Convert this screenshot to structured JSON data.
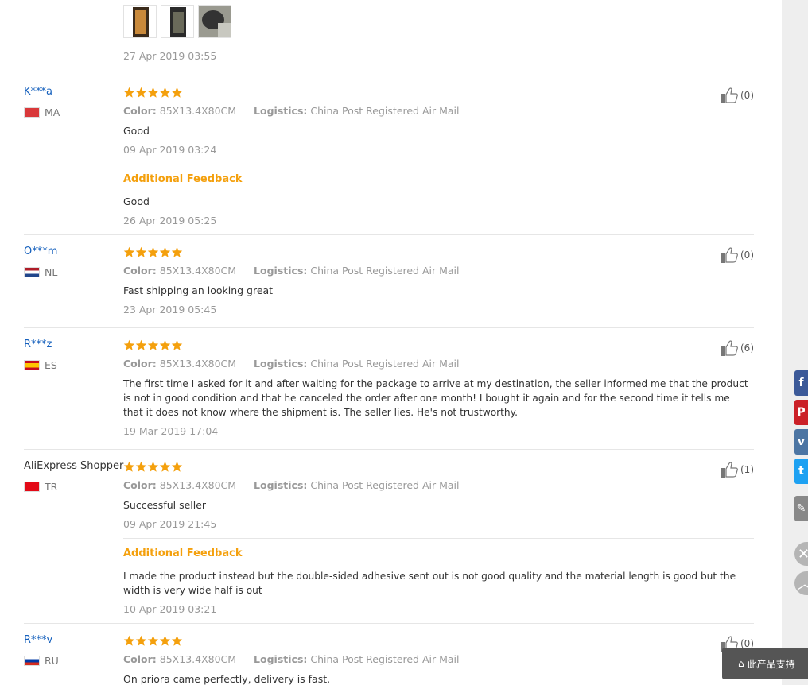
{
  "top_review": {
    "date": "27 Apr 2019 03:55"
  },
  "labels": {
    "color": "Color:",
    "logistics": "Logistics:",
    "additional_feedback": "Additional Feedback"
  },
  "reviews": [
    {
      "user": "K***a",
      "country": "MA",
      "stars": 5,
      "color": "85X13.4X80CM",
      "logistics": "China Post Registered Air Mail",
      "text": "Good",
      "date": "09 Apr 2019 03:24",
      "likes": "(0)",
      "additional_text": "Good",
      "additional_date": "26 Apr 2019 05:25"
    },
    {
      "user": "O***m",
      "country": "NL",
      "stars": 5,
      "color": "85X13.4X80CM",
      "logistics": "China Post Registered Air Mail",
      "text": "Fast shipping an looking great",
      "date": "23 Apr 2019 05:45",
      "likes": "(0)"
    },
    {
      "user": "R***z",
      "country": "ES",
      "stars": 5,
      "color": "85X13.4X80CM",
      "logistics": "China Post Registered Air Mail",
      "text": "The first time I asked for it and after waiting for the package to arrive at my destination, the seller informed me that the product is not in good condition and that he canceled the order after one month! I bought it again and for the second time it tells me that it does not know where the shipment is. The seller lies. He's not trustworthy.",
      "date": "19 Mar 2019 17:04",
      "likes": "(6)"
    },
    {
      "user": "AliExpress Shopper",
      "country": "TR",
      "stars": 5,
      "color": "85X13.4X80CM",
      "logistics": "China Post Registered Air Mail",
      "text": "Successful seller",
      "date": "09 Apr 2019 21:45",
      "likes": "(1)",
      "additional_text": "I made the product instead but the double-sided adhesive sent out is not good quality and the material length is good but the width is very wide half is out",
      "additional_date": "10 Apr 2019 03:21"
    },
    {
      "user": "R***v",
      "country": "RU",
      "stars": 5,
      "color": "85X13.4X80CM",
      "logistics": "China Post Registered Air Mail",
      "text": "On priora came perfectly, delivery is fast.",
      "likes": "(0)"
    }
  ],
  "share": {
    "facebook_color": "#3b5998",
    "pinterest_color": "#cb2027",
    "vk_color": "#4c75a3",
    "twitter_color": "#1da1f2",
    "edit_color": "#888888"
  },
  "chat_bar": {
    "label": "此产品支持"
  },
  "colors": {
    "link": "#1560bd",
    "star": "#f4a00d",
    "additional": "#f4a00d"
  }
}
